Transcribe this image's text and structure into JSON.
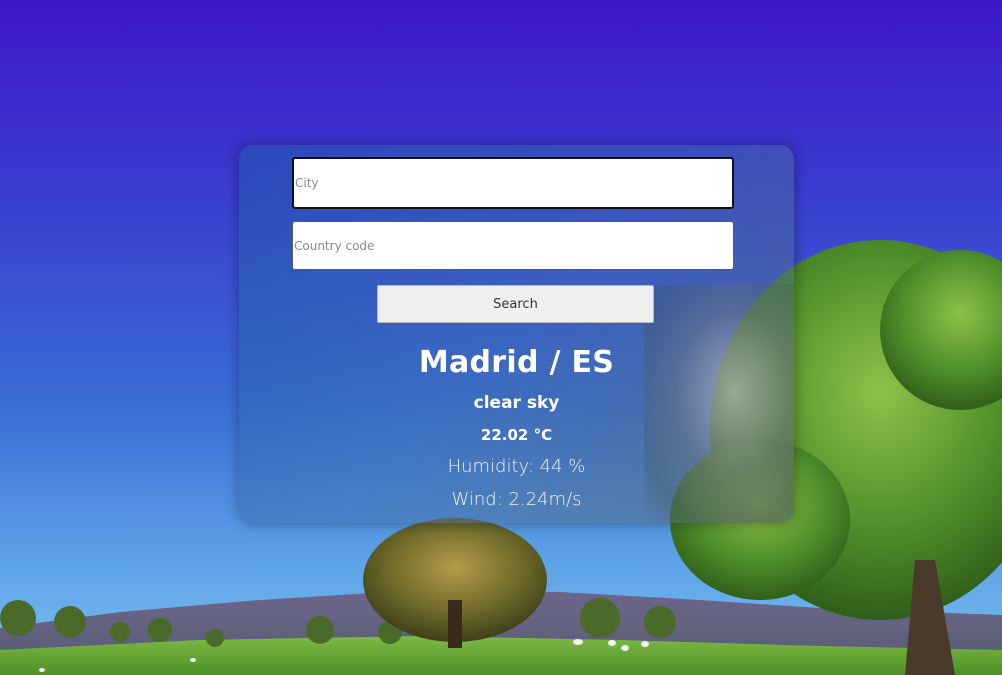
{
  "form": {
    "city_placeholder": "City",
    "city_value": "",
    "country_placeholder": "Country code",
    "country_value": "",
    "search_label": "Search"
  },
  "weather": {
    "location": "Madrid / ES",
    "description": "clear sky",
    "temperature": "22.02 °C",
    "humidity": "Humidity: 44 %",
    "wind": "Wind: 2.24m/s"
  },
  "colors": {
    "sky_top": "#3f17c9",
    "sky_bottom": "#7fc0ef",
    "grass": "#6fae3c",
    "card_text": "#ffffff"
  }
}
